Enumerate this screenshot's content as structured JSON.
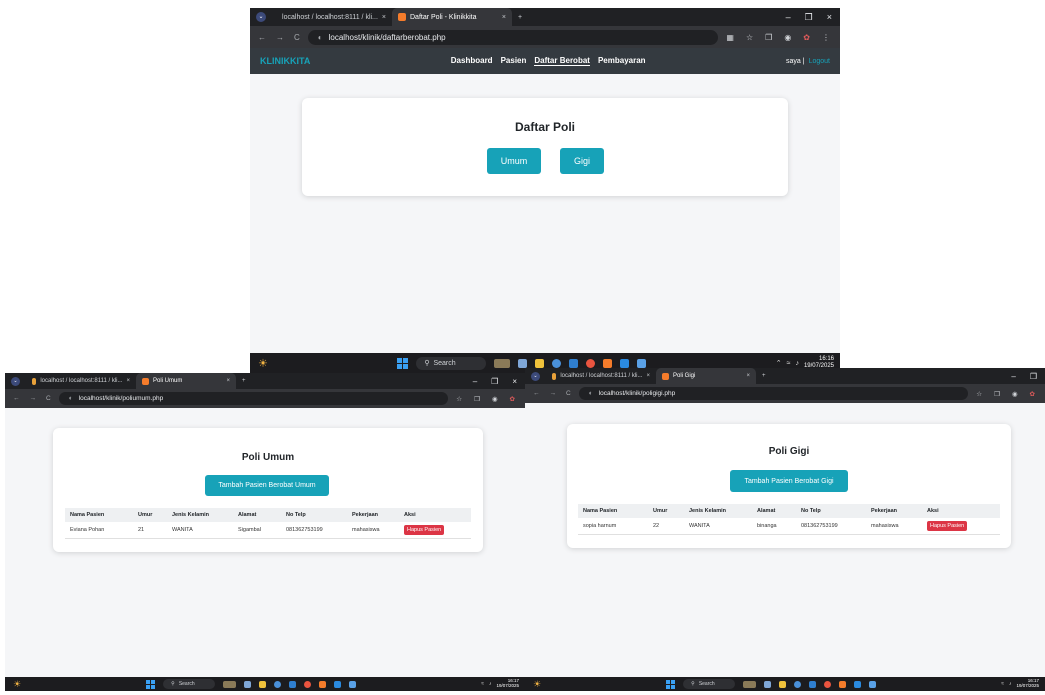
{
  "browser": {
    "tab_pma": "localhost / localhost:8111 / kli...",
    "close_glyph": "×",
    "newtab_glyph": "+",
    "min_glyph": "–",
    "max_glyph": "❐",
    "back_glyph": "←",
    "fwd_glyph": "→",
    "reload_glyph": "C"
  },
  "screen_main": {
    "tab_active": "Daftar Poli - Klinikkita",
    "url": "localhost/klinik/daftarberobat.php",
    "brand": "KLINIKKITA",
    "nav": [
      "Dashboard",
      "Pasien",
      "Daftar Berobat",
      "Pembayaran"
    ],
    "user": "saya |",
    "logout": "Logout",
    "card_title": "Daftar Poli",
    "btn_umum": "Umum",
    "btn_gigi": "Gigi",
    "search": "Search",
    "time": "16:16",
    "date": "19/07/2025"
  },
  "screen_umum": {
    "tab_active": "Poli Umum",
    "url": "localhost/klinik/poliumum.php",
    "card_title": "Poli Umum",
    "add_btn": "Tambah Pasien Berobat Umum",
    "headers": [
      "Nama Pasien",
      "Umur",
      "Jenis Kelamin",
      "Alamat",
      "No Telp",
      "Pekerjaan",
      "Aksi"
    ],
    "row": [
      "Eviana Pohan",
      "21",
      "WANITA",
      "Sigambal",
      "081362753199",
      "mahasiswa"
    ],
    "delete": "Hapus Pasien",
    "search": "Search",
    "time": "16:17",
    "date": "19/07/2025"
  },
  "screen_gigi": {
    "tab_active": "Poli Gigi",
    "url": "localhost/klinik/poligigi.php",
    "card_title": "Poli Gigi",
    "add_btn": "Tambah Pasien Berobat Gigi",
    "headers": [
      "Nama Pasien",
      "Umur",
      "Jenis Kelamin",
      "Alamat",
      "No Telp",
      "Pekerjaan",
      "Aksi"
    ],
    "row": [
      "sopia harnum",
      "22",
      "WANITA",
      "binanga",
      "081362753199",
      "mahasiswa"
    ],
    "delete": "Hapus Pasien",
    "search": "Search",
    "time": "16:17",
    "date": "19/07/2025"
  },
  "colors": {
    "accent": "#17a2b8",
    "danger": "#dc3545",
    "navbar": "#343a40"
  }
}
